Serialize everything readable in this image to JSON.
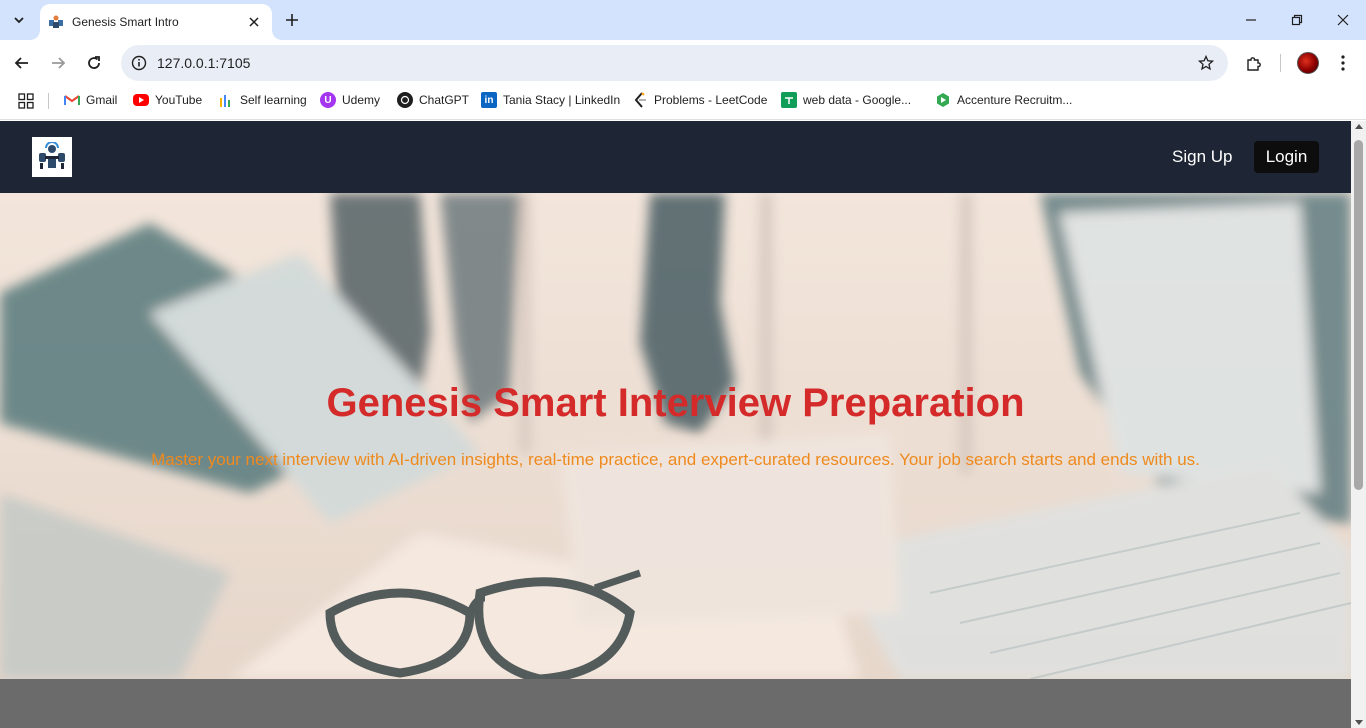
{
  "browser": {
    "tab": {
      "title": "Genesis Smart Intro"
    },
    "url": "127.0.0.1:7105",
    "bookmarks": [
      {
        "label": "Gmail",
        "icon": "gmail-icon"
      },
      {
        "label": "YouTube",
        "icon": "youtube-icon"
      },
      {
        "label": "Self learning",
        "icon": "self-learning-icon"
      },
      {
        "label": "Udemy",
        "icon": "udemy-icon"
      },
      {
        "label": "ChatGPT",
        "icon": "chatgpt-icon"
      },
      {
        "label": "Tania Stacy | LinkedIn",
        "icon": "linkedin-icon"
      },
      {
        "label": "Problems - LeetCode",
        "icon": "leetcode-icon"
      },
      {
        "label": "web data - Google...",
        "icon": "google-sheets-icon"
      },
      {
        "label": "Accenture Recruitm...",
        "icon": "accenture-icon"
      }
    ]
  },
  "site": {
    "nav": {
      "signup": "Sign Up",
      "login": "Login"
    },
    "hero": {
      "title": "Genesis Smart Interview Preparation",
      "subtitle": "Master your next interview with AI-driven insights, real-time practice, and expert-curated resources. Your job search starts and ends with us."
    }
  },
  "colors": {
    "header_bg": "#1e2535",
    "title": "#d42a2a",
    "subtitle": "#ee8a1e",
    "footer_bg": "#6b6b6b"
  }
}
